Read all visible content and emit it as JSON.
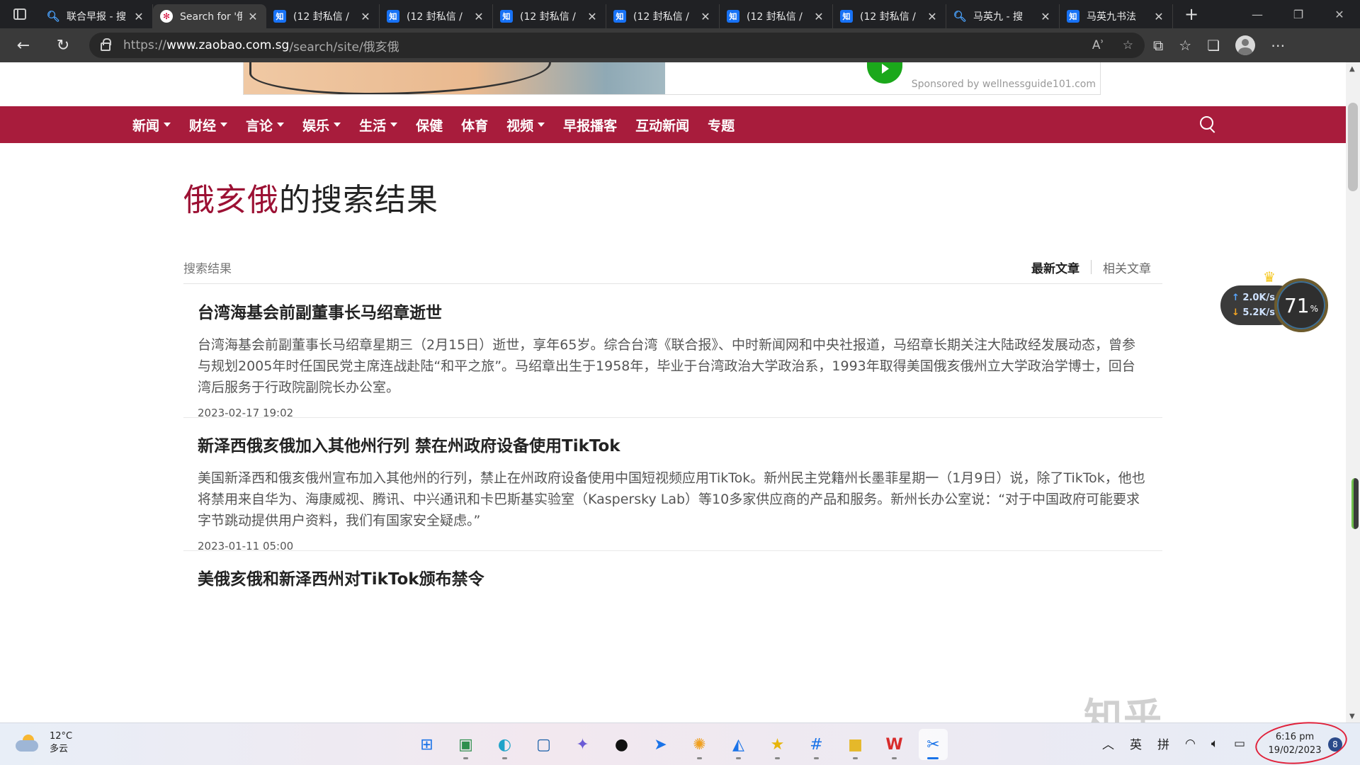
{
  "browser": {
    "tabs": [
      {
        "label": "联合早报 - 搜",
        "favicon": "search-icon",
        "active": false
      },
      {
        "label": "Search for '俄",
        "favicon": "zaobao-logo",
        "active": true
      },
      {
        "label": "(12 封私信 / ",
        "favicon": "zhihu-logo",
        "active": false
      },
      {
        "label": "(12 封私信 / ",
        "favicon": "zhihu-logo",
        "active": false
      },
      {
        "label": "(12 封私信 / ",
        "favicon": "zhihu-logo",
        "active": false
      },
      {
        "label": "(12 封私信 / ",
        "favicon": "zhihu-logo",
        "active": false
      },
      {
        "label": "(12 封私信 / ",
        "favicon": "zhihu-logo",
        "active": false
      },
      {
        "label": "(12 封私信 / ",
        "favicon": "zhihu-logo",
        "active": false
      },
      {
        "label": "马英九 - 搜",
        "favicon": "search-icon",
        "active": false
      },
      {
        "label": "马英九书法",
        "favicon": "zhihu-logo",
        "active": false
      }
    ],
    "url": {
      "scheme": "https://",
      "host": "www.zaobao.com.sg",
      "path": "/search/site/俄亥俄"
    }
  },
  "ad": {
    "sponsor": "Sponsored by wellnessguide101.com"
  },
  "nav": {
    "items": [
      {
        "label": "新闻",
        "dropdown": true
      },
      {
        "label": "财经",
        "dropdown": true
      },
      {
        "label": "言论",
        "dropdown": true
      },
      {
        "label": "娱乐",
        "dropdown": true
      },
      {
        "label": "生活",
        "dropdown": true
      },
      {
        "label": "保健",
        "dropdown": false
      },
      {
        "label": "体育",
        "dropdown": false
      },
      {
        "label": "视频",
        "dropdown": true
      },
      {
        "label": "早报播客",
        "dropdown": false
      },
      {
        "label": "互动新闻",
        "dropdown": false
      },
      {
        "label": "专题",
        "dropdown": false
      }
    ],
    "color": "#a81c3c"
  },
  "search": {
    "keyword": "俄亥俄",
    "title_suffix": "的搜索结果",
    "results_label": "搜索结果",
    "sort_latest": "最新文章",
    "sort_related": "相关文章"
  },
  "results": [
    {
      "title": "台湾海基会前副董事长马绍章逝世",
      "summary": "台湾海基会前副董事长马绍章星期三（2月15日）逝世，享年65岁。综合台湾《联合报》、中时新闻网和中央社报道，马绍章长期关注大陆政经发展动态，曾参与规划2005年时任国民党主席连战赴陆“和平之旅”。马绍章出生于1958年，毕业于台湾政治大学政治系，1993年取得美国俄亥俄州立大学政治学博士，回台湾后服务于行政院副院长办公室。",
      "date": "2023-02-17 19:02"
    },
    {
      "title": "新泽西俄亥俄加入其他州行列 禁在州政府设备使用TikTok",
      "summary": "美国新泽西和俄亥俄州宣布加入其他州的行列，禁止在州政府设备使用中国短视频应用TikTok。新州民主党籍州长墨菲星期一（1月9日）说，除了TikTok，他也将禁用来自华为、海康威视、腾讯、中兴通讯和卡巴斯基实验室（Kaspersky Lab）等10多家供应商的产品和服务。新州长办公室说：“对于中国政府可能要求字节跳动提供用户资料，我们有国家安全疑虑。”",
      "date": "2023-01-11 05:00"
    },
    {
      "title": "美俄亥俄和新泽西州对TikTok颁布禁令",
      "summary": "",
      "date": ""
    }
  ],
  "widget": {
    "upload": "2.0K/s",
    "download": "5.2K/s",
    "percent": "71",
    "percent_unit": "%"
  },
  "watermark": "知乎 @Hodix",
  "taskbar": {
    "weather_temp": "12°C",
    "weather_desc": "多云",
    "ime_lang": "英",
    "ime_mode": "拼",
    "time": "6:16 pm",
    "date": "19/02/2023",
    "notifications": "8"
  }
}
